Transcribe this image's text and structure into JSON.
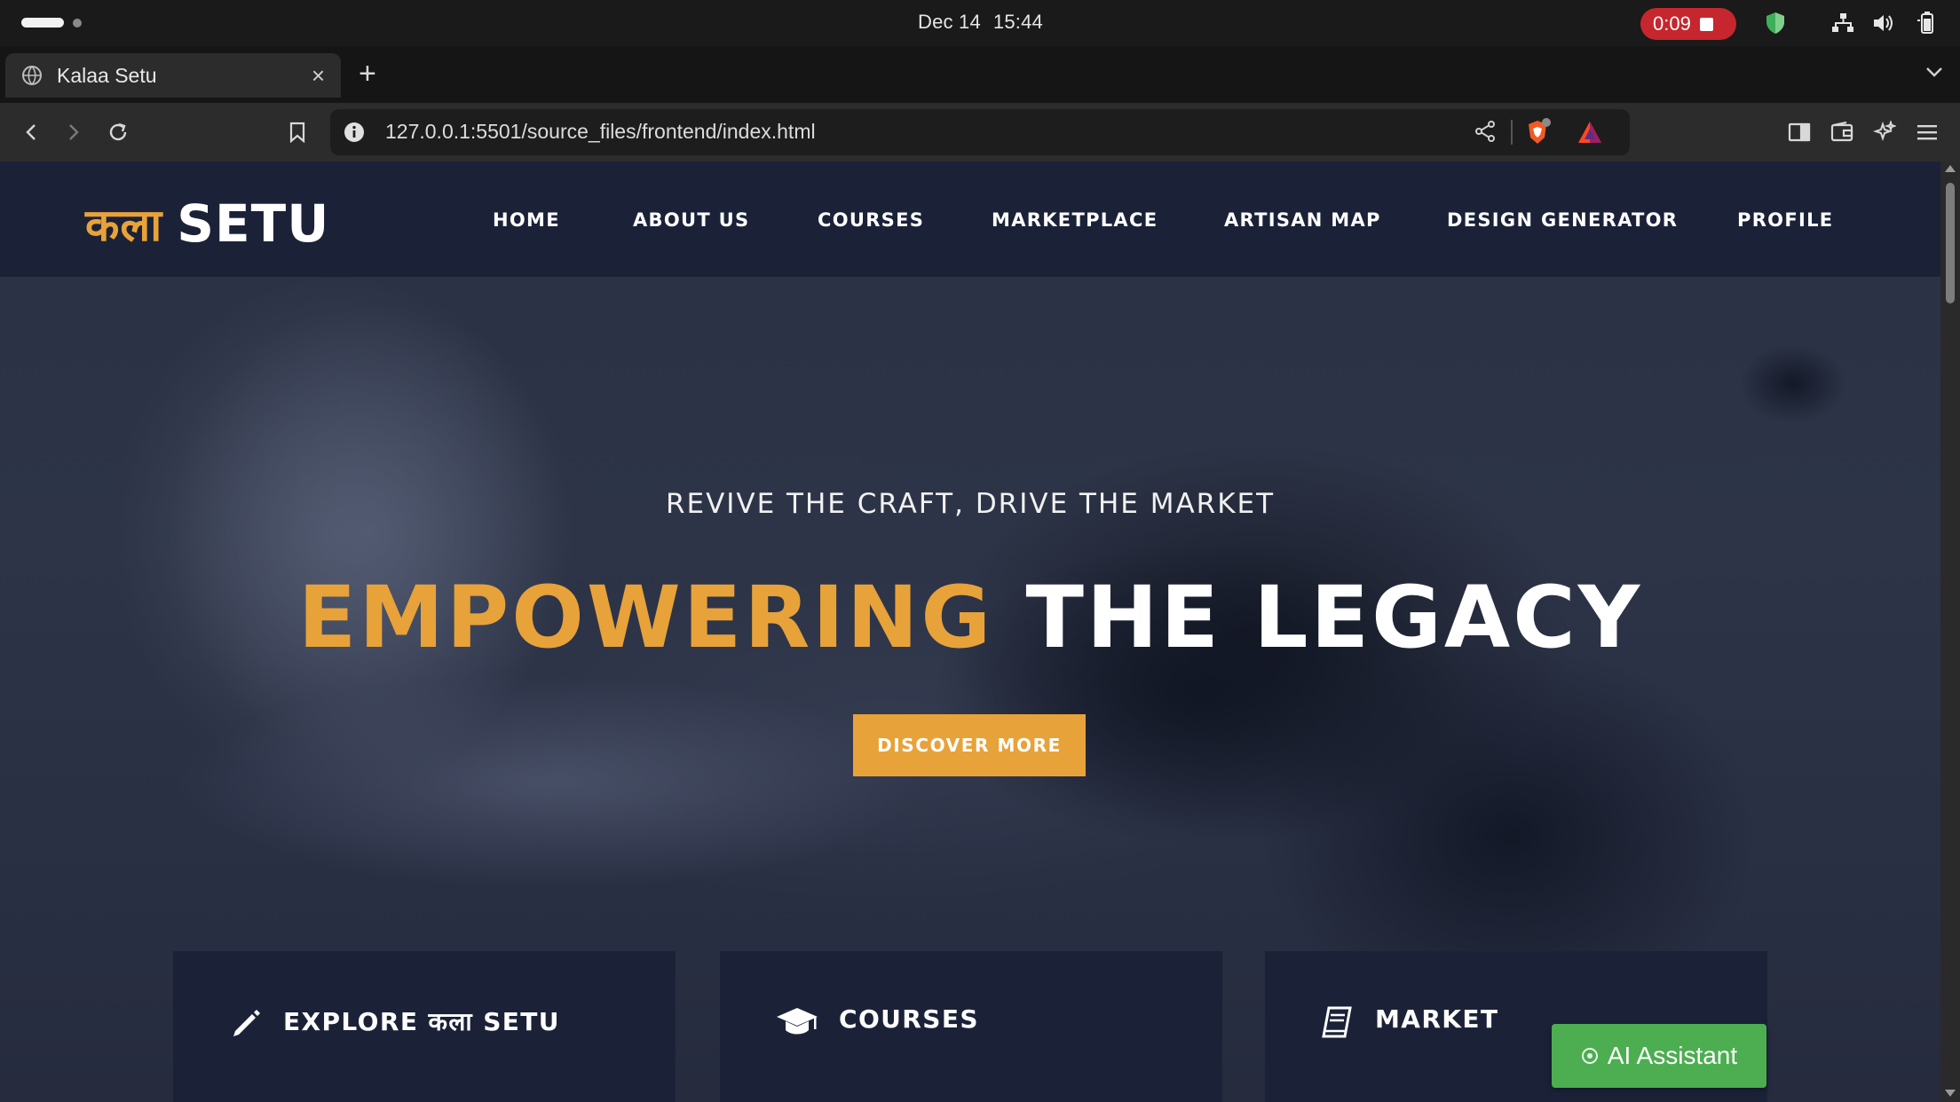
{
  "os": {
    "date": "Dec 14",
    "time": "15:44",
    "recording_timer": "0:09"
  },
  "browser": {
    "tab_title": "Kalaa Setu",
    "new_tab_symbol": "+",
    "tab_close_symbol": "×",
    "url": "127.0.0.1:5501/source_files/frontend/index.html"
  },
  "site": {
    "logo_hindi": "कला",
    "logo_english": "SETU",
    "nav": [
      "HOME",
      "ABOUT US",
      "COURSES",
      "MARKETPLACE",
      "ARTISAN MAP",
      "DESIGN GENERATOR",
      "PROFILE"
    ],
    "hero": {
      "subtitle": "REVIVE THE CRAFT, DRIVE THE MARKET",
      "title_accent": "EMPOWERING",
      "title_rest": "THE LEGACY",
      "cta_label": "DISCOVER MORE"
    },
    "features": [
      {
        "label": "EXPLORE कला SETU",
        "icon": "pencil-icon"
      },
      {
        "label": "COURSES",
        "icon": "graduation-cap-icon"
      },
      {
        "label": "MARKET",
        "icon": "book-icon"
      }
    ],
    "ai_assistant_label": "AI Assistant"
  },
  "colors": {
    "accent": "#e8a23a",
    "header_bg": "#1b2238",
    "ai_button": "#4cae50",
    "recording": "#c6262e"
  }
}
